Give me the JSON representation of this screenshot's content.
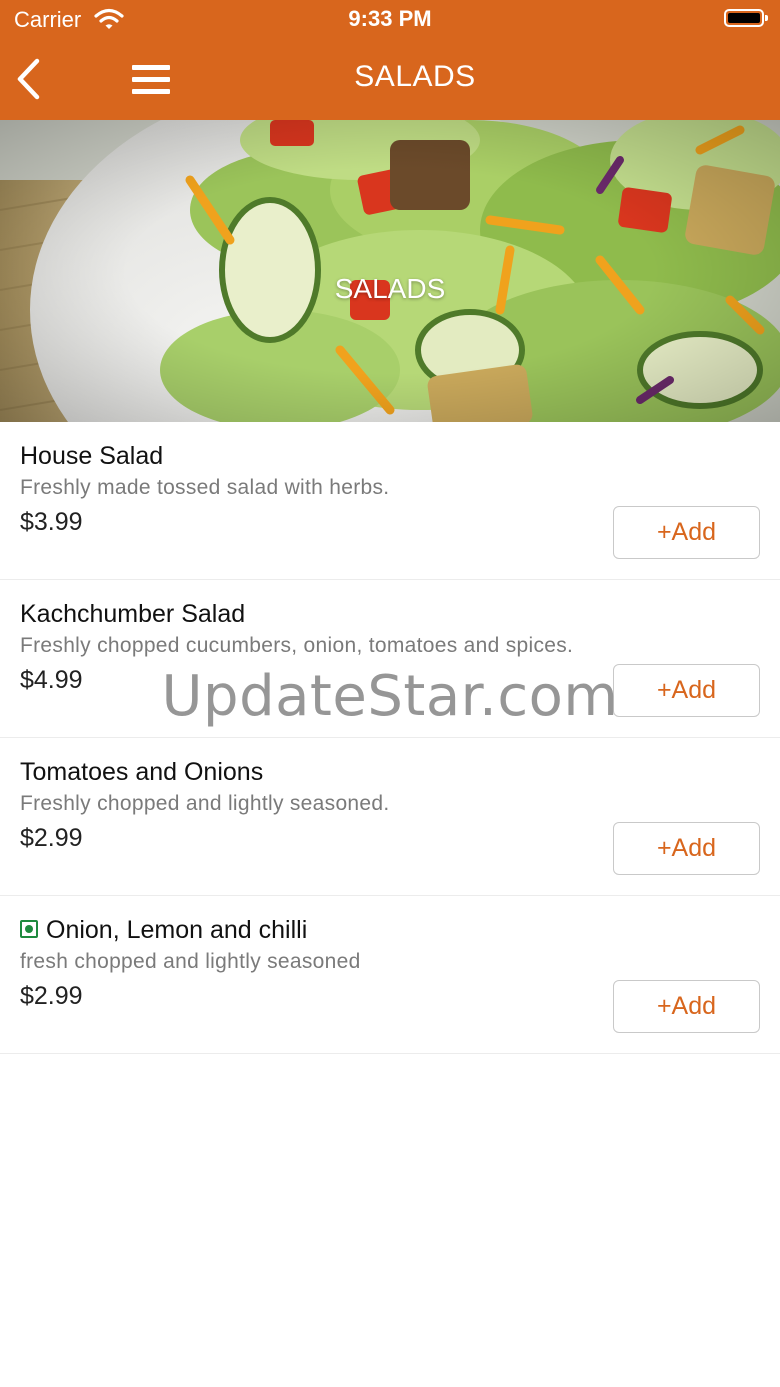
{
  "status_bar": {
    "carrier": "Carrier",
    "time": "9:33 PM",
    "icons": [
      "wifi-icon",
      "battery-icon"
    ]
  },
  "nav": {
    "title": "SALADS",
    "back_icon": "chevron-left-icon",
    "menu_icon": "hamburger-menu-icon"
  },
  "hero": {
    "title": "SALADS"
  },
  "items": [
    {
      "name": "House Salad",
      "description": "Freshly made tossed salad with herbs.",
      "price": "$3.99",
      "add_label": "+Add",
      "veg_badge": false
    },
    {
      "name": "Kachchumber Salad",
      "description": "Freshly chopped cucumbers, onion, tomatoes and spices.",
      "price": "$4.99",
      "add_label": "+Add",
      "veg_badge": false
    },
    {
      "name": "Tomatoes and Onions",
      "description": "Freshly chopped and lightly seasoned.",
      "price": "$2.99",
      "add_label": "+Add",
      "veg_badge": false
    },
    {
      "name": "Onion, Lemon and chilli",
      "description": "fresh chopped and lightly seasoned",
      "price": "$2.99",
      "add_label": "+Add",
      "veg_badge": true
    }
  ],
  "watermark": "UpdateStar.com",
  "colors": {
    "accent": "#d8661d",
    "veg_green": "#1e8a3e"
  }
}
